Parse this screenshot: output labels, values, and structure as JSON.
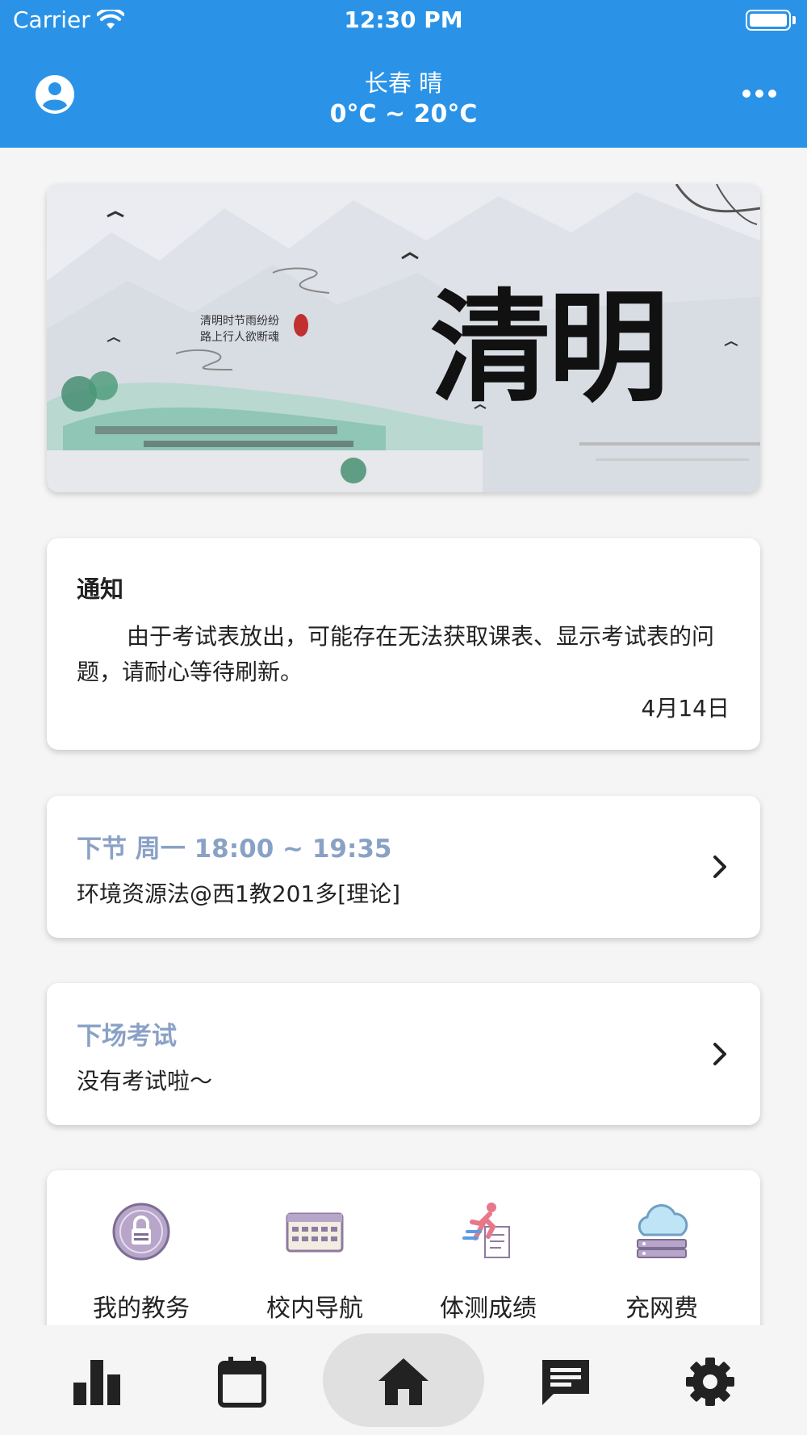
{
  "status_bar": {
    "carrier": "Carrier",
    "time": "12:30 PM"
  },
  "header": {
    "city_weather": "长春 晴",
    "temperature": "0°C ~ 20°C"
  },
  "banner": {
    "calligraphy": "清明",
    "poem": "清明时节雨纷纷 路上行人欲断魂"
  },
  "notice": {
    "title": "通知",
    "body": "由于考试表放出，可能存在无法获取课表、显示考试表的问题，请耐心等待刷新。",
    "date": "4月14日"
  },
  "next_class": {
    "title": "下节 周一 18:00 ~ 19:35",
    "detail": "环境资源法@西1教201多[理论]"
  },
  "next_exam": {
    "title": "下场考试",
    "detail": "没有考试啦～"
  },
  "quick_actions": [
    {
      "label": "我的教务",
      "icon": "lock-globe-icon"
    },
    {
      "label": "校内导航",
      "icon": "keyboard-icon"
    },
    {
      "label": "体测成绩",
      "icon": "runner-report-icon"
    },
    {
      "label": "充网费",
      "icon": "cloud-server-icon"
    }
  ],
  "bottom_nav": [
    {
      "name": "stats",
      "icon": "bar-chart-icon"
    },
    {
      "name": "schedule",
      "icon": "calendar-icon"
    },
    {
      "name": "home",
      "icon": "home-icon",
      "active": true
    },
    {
      "name": "messages",
      "icon": "message-icon"
    },
    {
      "name": "settings",
      "icon": "gear-icon"
    }
  ],
  "colors": {
    "primary": "#2a93e8",
    "accent_title": "#8aa1c6"
  }
}
